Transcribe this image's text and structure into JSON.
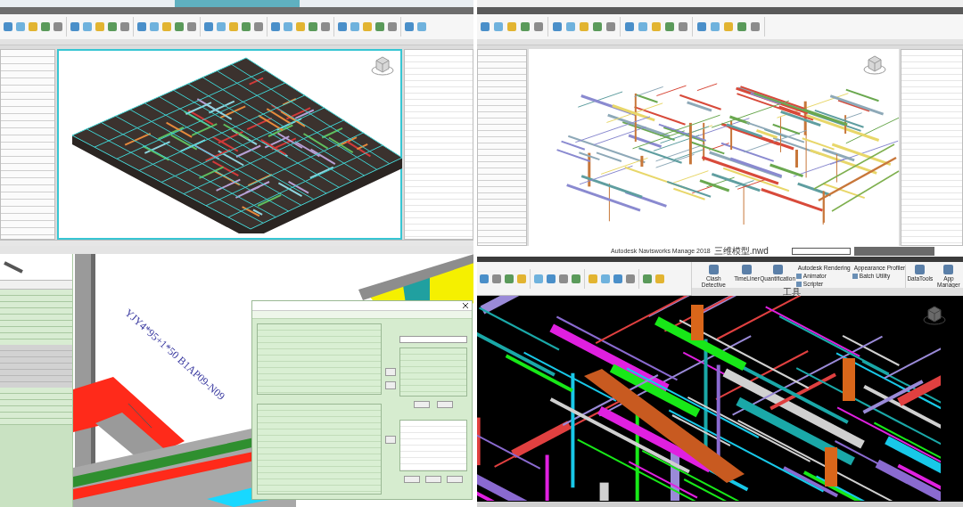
{
  "cable_view": {
    "annotation": "YJY4*95+1*50 B1AP09-N09"
  },
  "navisworks": {
    "title": "Autodesk Navisworks Manage 2018",
    "file": "三维模型.nwd",
    "tool_group": "工具",
    "large_tools": [
      {
        "label": "Clash Detective"
      },
      {
        "label": "TimeLiner"
      },
      {
        "label": "Quantification"
      }
    ],
    "small_tools": [
      {
        "label": "Autodesk Rendering"
      },
      {
        "label": "Animator"
      },
      {
        "label": "Scripter"
      },
      {
        "label": "Appearance Profiler"
      },
      {
        "label": "Batch Utility"
      }
    ],
    "data_tools": [
      {
        "label": "DataTools"
      },
      {
        "label": "App Manager"
      }
    ]
  }
}
